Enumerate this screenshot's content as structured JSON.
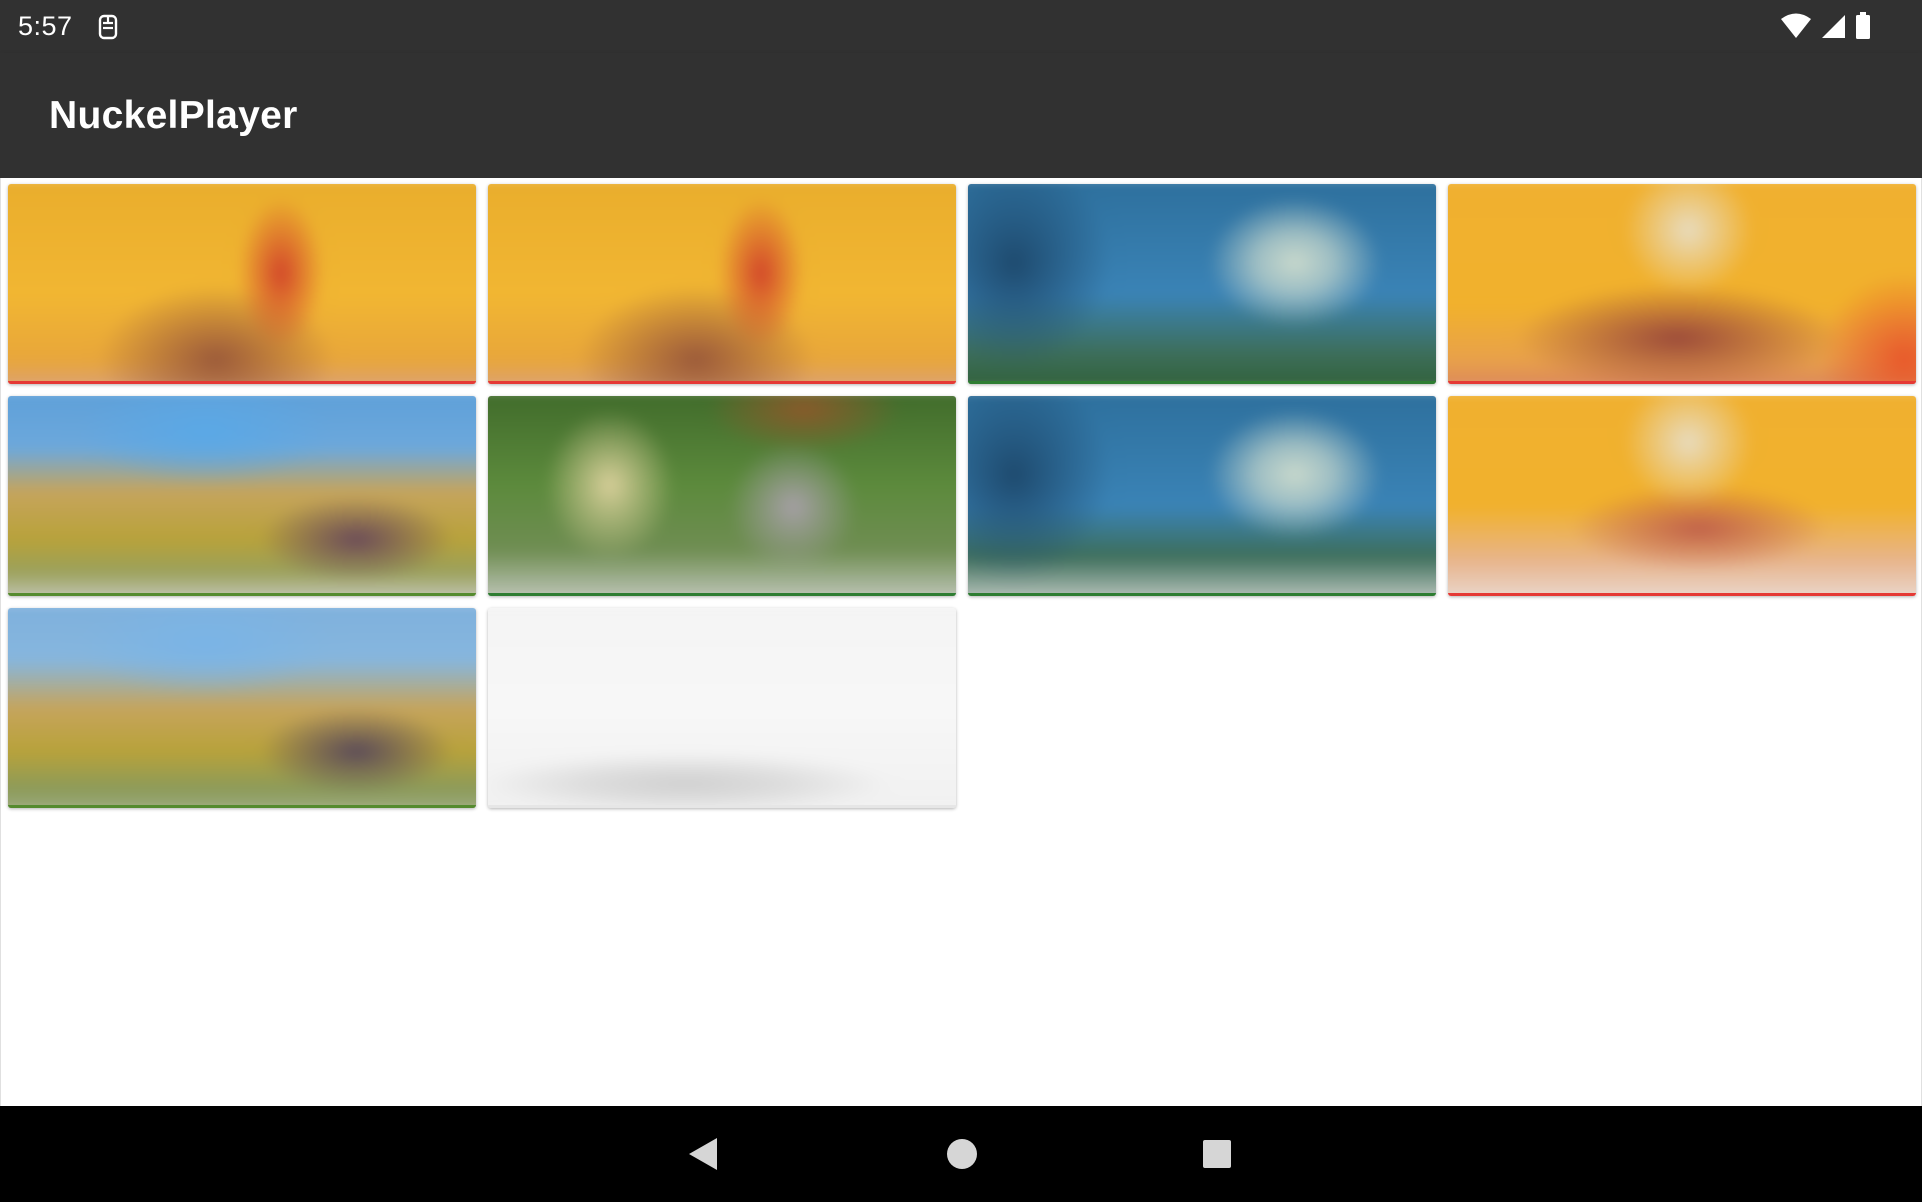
{
  "status_bar": {
    "time": "5:57",
    "notification_icon": "sim-card-alert-icon",
    "right_icons": [
      "wifi-icon",
      "cellular-signal-icon",
      "battery-icon"
    ]
  },
  "app_bar": {
    "title": "NuckelPlayer",
    "background": "#313131"
  },
  "media_grid": {
    "columns": 4,
    "tiles": [
      {
        "name": "video-thumbnail-1",
        "palette": "yellow-orange",
        "accent": "#e53935"
      },
      {
        "name": "video-thumbnail-2",
        "palette": "yellow-orange",
        "accent": "#e53935"
      },
      {
        "name": "video-thumbnail-3",
        "palette": "blue-sky",
        "accent": "#2e7d32"
      },
      {
        "name": "video-thumbnail-4",
        "palette": "yellow-red",
        "accent": "#e53935"
      },
      {
        "name": "video-thumbnail-5",
        "palette": "blue-field",
        "accent": "#558b2f"
      },
      {
        "name": "video-thumbnail-6",
        "palette": "green-forest",
        "accent": "#2e7d32"
      },
      {
        "name": "video-thumbnail-7",
        "palette": "blue-sky",
        "accent": "#2e7d32"
      },
      {
        "name": "video-thumbnail-8",
        "palette": "yellow-red",
        "accent": "#e53935"
      },
      {
        "name": "video-thumbnail-9",
        "palette": "blue-field",
        "accent": "#558b2f"
      },
      {
        "name": "video-thumbnail-10",
        "palette": "white-grey",
        "accent": "#cfcfcf"
      }
    ]
  },
  "nav_bar": {
    "buttons": [
      "back-icon",
      "home-icon",
      "recents-icon"
    ]
  }
}
